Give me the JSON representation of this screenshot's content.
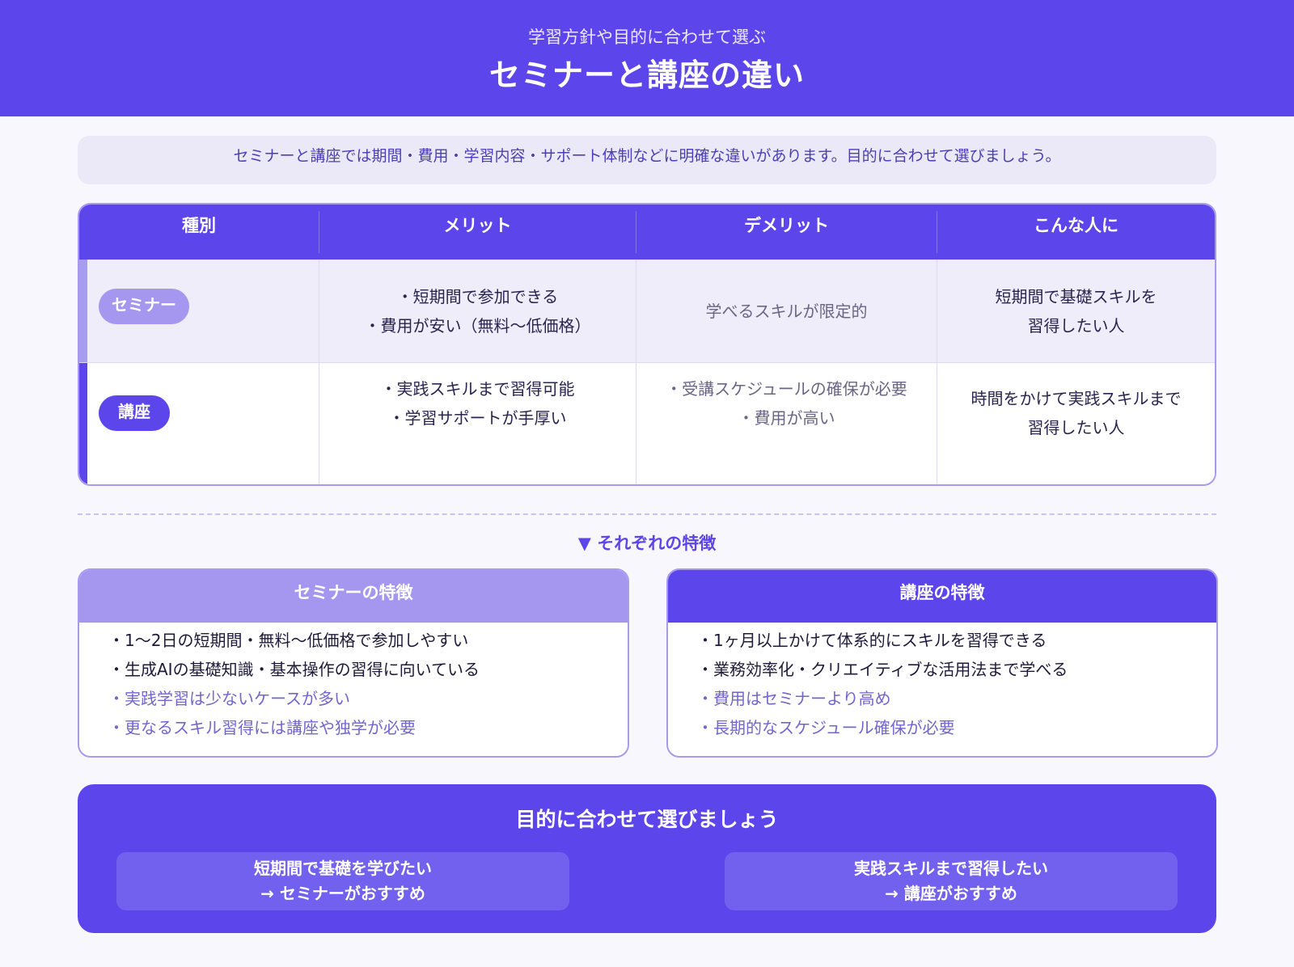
{
  "header": {
    "subtitle": "学習方針や目的に合わせて選ぶ",
    "title": "セミナーと講座の違い"
  },
  "intro": "セミナーと講座では期間・費用・学習内容・サポート体制などに明確な違いがあります。目的に合わせて選びましょう。",
  "table": {
    "headers": [
      "種別",
      "メリット",
      "デメリット",
      "こんな人に"
    ],
    "rows": [
      {
        "type": "セミナー",
        "merit1": "・短期間で参加できる",
        "merit2": "・費用が安い（無料〜低価格）",
        "demerit1": "学べるスキルが限定的",
        "target1": "短期間で基礎スキルを",
        "target2": "習得したい人"
      },
      {
        "type": "講座",
        "merit1": "・実践スキルまで習得可能",
        "merit2": "・学習サポートが手厚い",
        "demerit1": "・受講スケジュールの確保が必要",
        "demerit2": "・費用が高い",
        "target1": "時間をかけて実践スキルまで",
        "target2": "習得したい人"
      }
    ]
  },
  "features_label": "▼ それぞれの特徴",
  "cards": {
    "seminar": {
      "title": "セミナーの特徴",
      "items": [
        "・1〜2日の短期間・無料〜低価格で参加しやすい",
        "・生成AIの基礎知識・基本操作の習得に向いている",
        "・実践学習は少ないケースが多い",
        "・更なるスキル習得には講座や独学が必要"
      ]
    },
    "course": {
      "title": "講座の特徴",
      "items": [
        "・1ヶ月以上かけて体系的にスキルを習得できる",
        "・業務効率化・クリエイティブな活用法まで学べる",
        "・費用はセミナーより高め",
        "・長期的なスケジュール確保が必要"
      ]
    }
  },
  "cta": {
    "title": "目的に合わせて選びましょう",
    "option_a_line1": "短期間で基礎を学びたい",
    "option_a_line2": "→ セミナーがおすすめ",
    "option_b_line1": "実践スキルまで習得したい",
    "option_b_line2": "→ 講座がおすすめ"
  },
  "colors": {
    "primary": "#5c46eb",
    "light": "#a597f0",
    "background": "#f8f7fd"
  }
}
